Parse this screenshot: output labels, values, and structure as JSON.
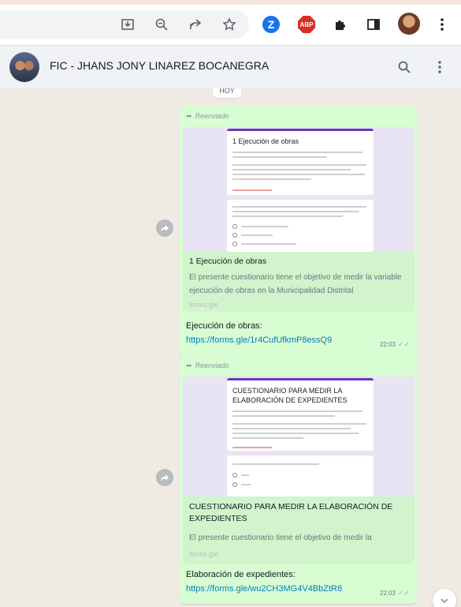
{
  "browser": {
    "icons": [
      "install-icon",
      "zoom-icon",
      "share-icon",
      "bookmark-star-icon",
      "extension-z-icon",
      "extension-abp-icon",
      "extensions-puzzle-icon",
      "side-panel-icon",
      "profile-avatar",
      "menu-kebab-icon"
    ],
    "abp_label": "ABP",
    "z_label": "Z"
  },
  "chat": {
    "title": "FIC - JHANS JONY LINAREZ BOCANEGRA",
    "day_chip": "HOY"
  },
  "messages": [
    {
      "forwarded_label": "Reenviado",
      "preview_image": {
        "form_title": "1 Ejecución de obras"
      },
      "preview_title": "1 Ejecución de obras",
      "preview_description": "El presente cuestionario tiene el objetivo de medir la variable ejecución de obras en la Municipalidad Distrital",
      "preview_domain": "forms.gle",
      "text": "Ejecución de obras:",
      "link": "https://forms.gle/1r4CufUfkmP8essQ9",
      "time": "22:03"
    },
    {
      "forwarded_label": "Reenviado",
      "preview_image": {
        "form_title": "CUESTIONARIO PARA MEDIR LA ELABORACIÓN DE EXPEDIENTES"
      },
      "preview_title": "CUESTIONARIO PARA MEDIR LA ELABORACIÓN DE EXPEDIENTES",
      "preview_description": "El presente cuestionario tiene el objetivo de medir la",
      "preview_domain": "forms.gle",
      "text": "Elaboración de expedientes:",
      "link": "https://forms.gle/wu2CH3MG4V4BbZtR8",
      "time": "22:03"
    }
  ],
  "colors": {
    "bubble_out": "#d9fdd3",
    "link": "#027eb5",
    "chat_bg": "#efeae2",
    "form_accent": "#673ab7"
  }
}
